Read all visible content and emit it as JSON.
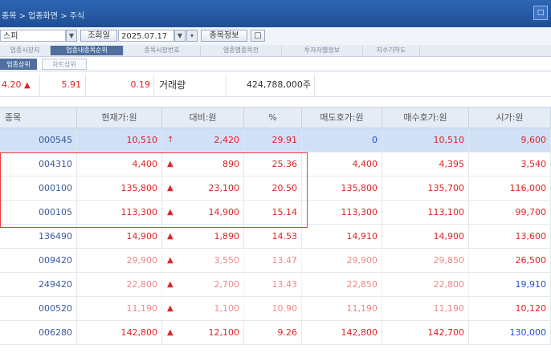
{
  "titlebar": {
    "breadcrumb": "종목 > 업종화면 > 주식",
    "win_btn": "□"
  },
  "toolbar": {
    "market_select": "스피",
    "query_label": "조회일",
    "date_value": "2025.07.17",
    "detail_button": "종목정보",
    "misc_button": "□"
  },
  "tabs_top": [
    "업종시장지",
    "업종내종목순위",
    "종목시장번호",
    "업종별종목전",
    "투자자별정보",
    "지수기하도"
  ],
  "tabs_sub": [
    "업종상위",
    "차트상위"
  ],
  "summary": {
    "index_value": "4.20",
    "change_value": "5.91",
    "rate_value": "0.19",
    "volume_label": "거래량",
    "volume_value": "424,788,000주"
  },
  "table": {
    "headers": [
      "종목",
      "현재가:원",
      "대비:원",
      "%",
      "매도호가:원",
      "매수호가:원",
      "시가:원"
    ],
    "rows": [
      {
        "code": "000545",
        "price": "10,510",
        "sym": "↑",
        "diff": "2,420",
        "pct": "29.91",
        "ask": "0",
        "bid": "10,510",
        "open": "9,600",
        "open_color": "red",
        "selected": true
      },
      {
        "code": "004310",
        "price": "4,400",
        "sym": "▲",
        "diff": "890",
        "pct": "25.36",
        "ask": "4,400",
        "bid": "4,395",
        "open": "3,540",
        "open_color": "red"
      },
      {
        "code": "000100",
        "price": "135,800",
        "sym": "▲",
        "diff": "23,100",
        "pct": "20.50",
        "ask": "135,800",
        "bid": "135,700",
        "open": "116,000",
        "open_color": "red"
      },
      {
        "code": "000105",
        "price": "113,300",
        "sym": "▲",
        "diff": "14,900",
        "pct": "15.14",
        "ask": "113,300",
        "bid": "113,100",
        "open": "99,700",
        "open_color": "red"
      },
      {
        "code": "136490",
        "price": "14,900",
        "sym": "▲",
        "diff": "1,890",
        "pct": "14.53",
        "ask": "14,910",
        "bid": "14,900",
        "open": "13,600",
        "open_color": "red"
      },
      {
        "code": "009420",
        "price": "29,900",
        "sym": "▲",
        "diff": "3,550",
        "pct": "13.47",
        "ask": "29,900",
        "bid": "29,850",
        "open": "26,500",
        "open_color": "red",
        "faded": true
      },
      {
        "code": "249420",
        "price": "22,800",
        "sym": "▲",
        "diff": "2,700",
        "pct": "13.43",
        "ask": "22,850",
        "bid": "22,800",
        "open": "19,910",
        "open_color": "blue",
        "faded": true
      },
      {
        "code": "000520",
        "price": "11,190",
        "sym": "▲",
        "diff": "1,100",
        "pct": "10.90",
        "ask": "11,190",
        "bid": "11,190",
        "open": "10,120",
        "open_color": "red",
        "faded": true
      },
      {
        "code": "006280",
        "price": "142,800",
        "sym": "▲",
        "diff": "12,100",
        "pct": "9.26",
        "ask": "142,800",
        "bid": "142,700",
        "open": "130,000",
        "open_color": "blue"
      }
    ]
  },
  "colors": {
    "up": "#e02323",
    "down": "#2450c8",
    "selected_row": "#cfe0f7",
    "highlight_box": "#ec3d3d"
  }
}
